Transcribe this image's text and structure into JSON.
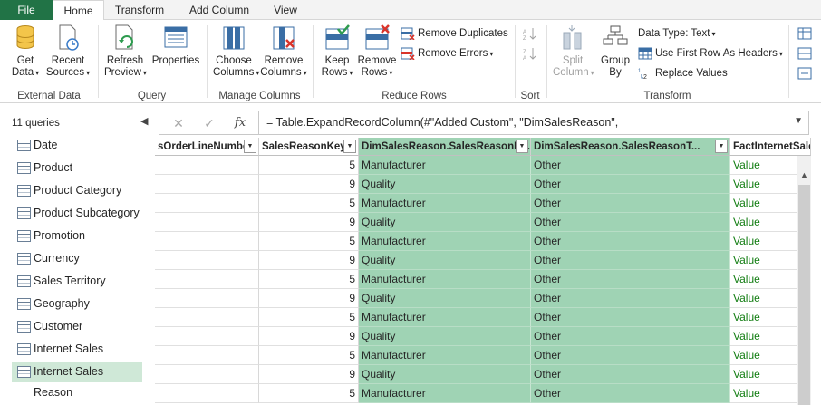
{
  "tabs": {
    "file": "File",
    "items": [
      "Home",
      "Transform",
      "Add Column",
      "View"
    ]
  },
  "ribbon": {
    "external_data": {
      "label": "External Data",
      "get_data": [
        "Get",
        "Data"
      ],
      "recent_sources": [
        "Recent",
        "Sources"
      ]
    },
    "query": {
      "label": "Query",
      "refresh_preview": [
        "Refresh",
        "Preview"
      ],
      "properties": "Properties"
    },
    "manage_columns": {
      "label": "Manage Columns",
      "choose_columns": [
        "Choose",
        "Columns"
      ],
      "remove_columns": [
        "Remove",
        "Columns"
      ]
    },
    "reduce_rows": {
      "label": "Reduce Rows",
      "keep_rows": [
        "Keep",
        "Rows"
      ],
      "remove_rows": [
        "Remove",
        "Rows"
      ],
      "remove_duplicates": "Remove Duplicates",
      "remove_errors": "Remove Errors"
    },
    "sort": {
      "label": "Sort"
    },
    "transform": {
      "label": "Transform",
      "split_column": [
        "Split",
        "Column"
      ],
      "group_by": [
        "Group",
        "By"
      ],
      "data_type": "Data Type: Text",
      "use_first_row": "Use First Row As Headers",
      "replace_values": "Replace Values"
    }
  },
  "queries": {
    "header": "11 queries",
    "collapse_icon": "chevron-left",
    "items": [
      "Date",
      "Product",
      "Product Category",
      "Product Subcategory",
      "Promotion",
      "Currency",
      "Sales Territory",
      "Geography",
      "Customer",
      "Internet Sales",
      "Internet Sales Reason"
    ],
    "selected": "Internet Sales Reason"
  },
  "formula_bar": {
    "cancel": "✕",
    "commit": "✓",
    "fx": "fx",
    "formula": "= Table.ExpandRecordColumn(#\"Added Custom\", \"DimSalesReason\","
  },
  "grid": {
    "columns": [
      "sOrderLineNumber",
      "SalesReasonKey",
      "DimSalesReason.SalesReasonNa...",
      "DimSalesReason.SalesReasonT...",
      "FactInternetSales"
    ],
    "rows": [
      [
        "",
        "5",
        "Manufacturer",
        "Other",
        "Value"
      ],
      [
        "",
        "9",
        "Quality",
        "Other",
        "Value"
      ],
      [
        "",
        "5",
        "Manufacturer",
        "Other",
        "Value"
      ],
      [
        "",
        "9",
        "Quality",
        "Other",
        "Value"
      ],
      [
        "",
        "5",
        "Manufacturer",
        "Other",
        "Value"
      ],
      [
        "",
        "9",
        "Quality",
        "Other",
        "Value"
      ],
      [
        "",
        "5",
        "Manufacturer",
        "Other",
        "Value"
      ],
      [
        "",
        "9",
        "Quality",
        "Other",
        "Value"
      ],
      [
        "",
        "5",
        "Manufacturer",
        "Other",
        "Value"
      ],
      [
        "",
        "9",
        "Quality",
        "Other",
        "Value"
      ],
      [
        "",
        "5",
        "Manufacturer",
        "Other",
        "Value"
      ],
      [
        "",
        "9",
        "Quality",
        "Other",
        "Value"
      ],
      [
        "",
        "5",
        "Manufacturer",
        "Other",
        "Value"
      ]
    ]
  },
  "colors": {
    "accent": "#217346",
    "selected_column": "#9fd3b4",
    "selected_query": "#cfe8d7",
    "link": "#107c10"
  }
}
